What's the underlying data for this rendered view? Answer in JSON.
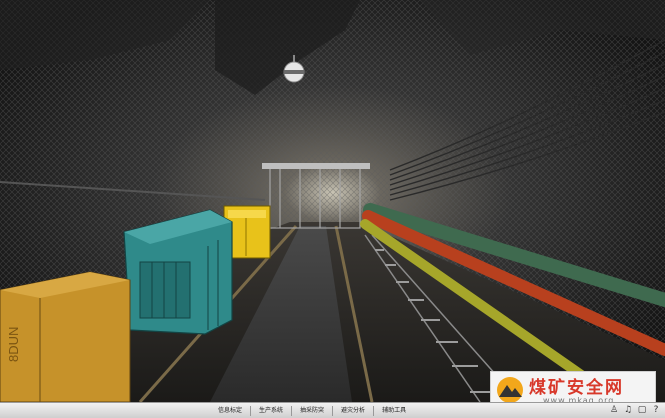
{
  "menu": {
    "items": [
      {
        "label": "信息标定"
      },
      {
        "label": "生产系统"
      },
      {
        "label": "抽采防突"
      },
      {
        "label": "避灾分析"
      },
      {
        "label": "辅助工具"
      }
    ]
  },
  "tray": {
    "icons": [
      "person-icon",
      "speaker-icon",
      "window-icon",
      "help-icon"
    ]
  },
  "watermark": {
    "name": "煤矿安全网",
    "url": "www.mkaq.org"
  },
  "scene": {
    "cart_label": "8DUN",
    "colors": {
      "teal_car": "#2f8a8a",
      "yellow_car": "#e8c21a",
      "cargo_box": "#c6922a",
      "red_pipe": "#b8401e",
      "yellow_pipe": "#a6a62a",
      "green_pipe": "#3f6a4f",
      "brand_red": "#d8382a"
    }
  }
}
